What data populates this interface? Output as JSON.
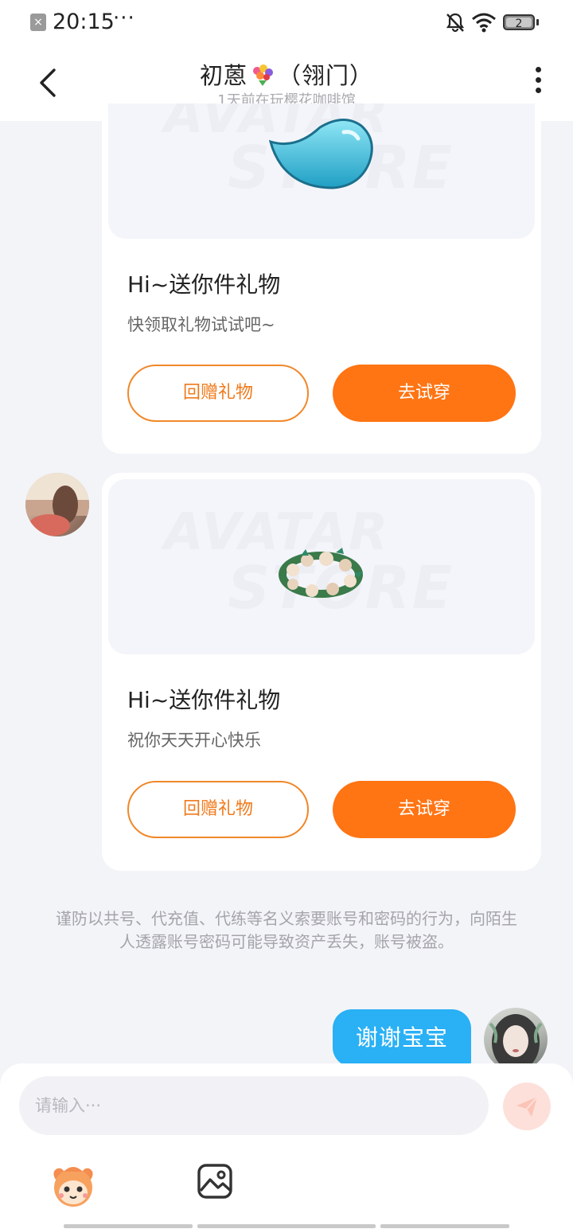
{
  "status_bar": {
    "time": "20:15",
    "dots": "···",
    "battery": "2"
  },
  "header": {
    "title_left": "初蒽",
    "title_right": "（翎门）",
    "subtitle": "1天前在玩樱花咖啡馆"
  },
  "gift_cards": [
    {
      "title": "Hi~送你件礼物",
      "message": "快领取礼物试试吧~",
      "return_label": "回赠礼物",
      "try_label": "去试穿"
    },
    {
      "title": "Hi~送你件礼物",
      "message": "祝你天天开心快乐",
      "return_label": "回赠礼物",
      "try_label": "去试穿"
    }
  ],
  "warning": "谨防以共号、代充值、代练等名义索要账号和密码的行为，向陌生人透露账号密码可能导致资产丢失，账号被盗。",
  "outgoing_message": "谢谢宝宝",
  "input": {
    "placeholder": "请输入···"
  },
  "colors": {
    "accent_orange": "#ff7413",
    "bubble_blue": "#29b0f5"
  }
}
